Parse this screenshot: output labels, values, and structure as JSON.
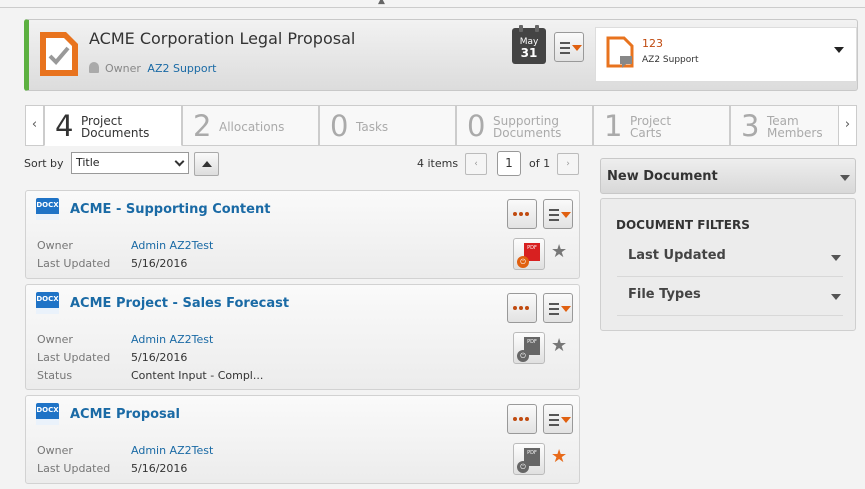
{
  "header": {
    "title": "ACME Corporation Legal Proposal",
    "owner_label": "Owner",
    "owner_name": "AZ2 Support",
    "calendar": {
      "month": "May",
      "day": "31"
    },
    "panel": {
      "number": "123",
      "user": "AZ2 Support"
    },
    "accent_color": "#5cb040"
  },
  "tabs": [
    {
      "count": "4",
      "line1": "Project",
      "line2": "Documents",
      "active": true
    },
    {
      "count": "2",
      "line1": "Allocations",
      "line2": "",
      "active": false
    },
    {
      "count": "0",
      "line1": "Tasks",
      "line2": "",
      "active": false
    },
    {
      "count": "0",
      "line1": "Supporting",
      "line2": "Documents",
      "active": false
    },
    {
      "count": "1",
      "line1": "Project",
      "line2": "Carts",
      "active": false
    },
    {
      "count": "3",
      "line1": "Team",
      "line2": "Members",
      "active": false
    }
  ],
  "sort": {
    "label": "Sort by",
    "value": "Title",
    "items_count": "4 items",
    "page": "1",
    "of_pages": "of 1"
  },
  "documents": [
    {
      "type": "DOCX",
      "title": "ACME - Supporting Content",
      "owner_label": "Owner",
      "owner": "Admin AZ2Test",
      "updated_label": "Last Updated",
      "updated": "5/16/2016",
      "pdf_state": "red",
      "starred": false
    },
    {
      "type": "DOCX",
      "title": "ACME Project - Sales Forecast",
      "owner_label": "Owner",
      "owner": "Admin AZ2Test",
      "updated_label": "Last Updated",
      "updated": "5/16/2016",
      "status_label": "Status",
      "status": "Content Input - Compl...",
      "pdf_state": "grey",
      "starred": false
    },
    {
      "type": "DOCX",
      "title": "ACME Proposal",
      "owner_label": "Owner",
      "owner": "Admin AZ2Test",
      "updated_label": "Last Updated",
      "updated": "5/16/2016",
      "pdf_state": "grey",
      "starred": true
    }
  ],
  "sidebar": {
    "new_document": "New Document",
    "filters_title": "DOCUMENT FILTERS",
    "filters": [
      "Last Updated",
      "File Types"
    ]
  },
  "icons": {
    "pdf_label": "PDF",
    "prev_tab": "‹",
    "next_tab": "›",
    "prev_page": "‹",
    "next_page": "›",
    "star": "★"
  }
}
